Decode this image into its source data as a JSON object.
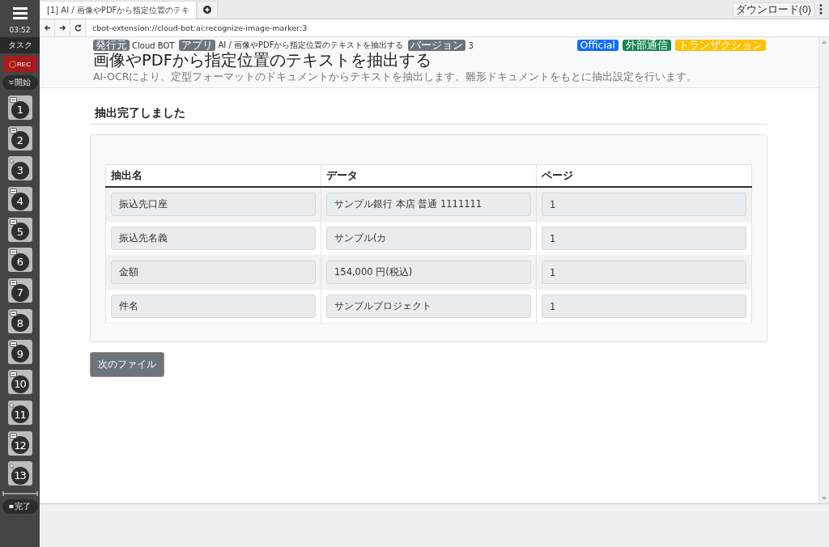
{
  "sidebar": {
    "time": "03:52",
    "task_label": "タスク",
    "rec_label": "REC",
    "start_label": "開始",
    "end_label": "完了",
    "steps": [
      {
        "label": "1",
        "kind": "form"
      },
      {
        "label": "2",
        "kind": "form"
      },
      {
        "label": "3",
        "kind": "cursor"
      },
      {
        "label": "4",
        "kind": "form"
      },
      {
        "label": "5",
        "kind": "form"
      },
      {
        "label": "6",
        "kind": "form"
      },
      {
        "label": "7",
        "kind": "form"
      },
      {
        "label": "8",
        "kind": "form"
      },
      {
        "label": "9",
        "kind": "form"
      },
      {
        "label": "10",
        "kind": "form"
      },
      {
        "label": "11",
        "kind": "cursor"
      },
      {
        "label": "12",
        "kind": "form"
      },
      {
        "label": "13",
        "kind": "cursor"
      }
    ]
  },
  "browser": {
    "tabs": [
      {
        "label": "[1] AI / 画像やPDFから指定位置のテキ",
        "selected": true
      }
    ],
    "download_button": "ダウンロード(0)",
    "address": "cbot-extension://cloud-bot:ai:recognize-image-marker:3"
  },
  "header": {
    "meta": [
      {
        "tag": "発行元",
        "value": "Cloud BOT"
      },
      {
        "tag": "アプリ",
        "value": "AI / 画像やPDFから指定位置のテキストを抽出する"
      },
      {
        "tag": "バージョン",
        "value": "3"
      }
    ],
    "badges": [
      {
        "label": "Official",
        "color": "#0d6efd"
      },
      {
        "label": "外部通信",
        "color": "#198754"
      },
      {
        "label": "トランザクション",
        "color": "#ffc107"
      }
    ],
    "title": "画像やPDFから指定位置のテキストを抽出する",
    "description": "AI-OCRにより、定型フォーマットのドキュメントからテキストを抽出します。雛形ドキュメントをもとに抽出設定を行います。"
  },
  "section_title": "抽出完了しました",
  "table": {
    "columns": [
      "抽出名",
      "データ",
      "ページ"
    ],
    "rows": [
      [
        "振込先口座",
        "サンプル銀行 本店 普通 1111111",
        "1"
      ],
      [
        "振込先名義",
        "サンプル(カ",
        "1"
      ],
      [
        "金額",
        "154,000 円(税込)",
        "1"
      ],
      [
        "件名",
        "サンプルプロジェクト",
        "1"
      ]
    ]
  },
  "next_button": "次のファイル"
}
